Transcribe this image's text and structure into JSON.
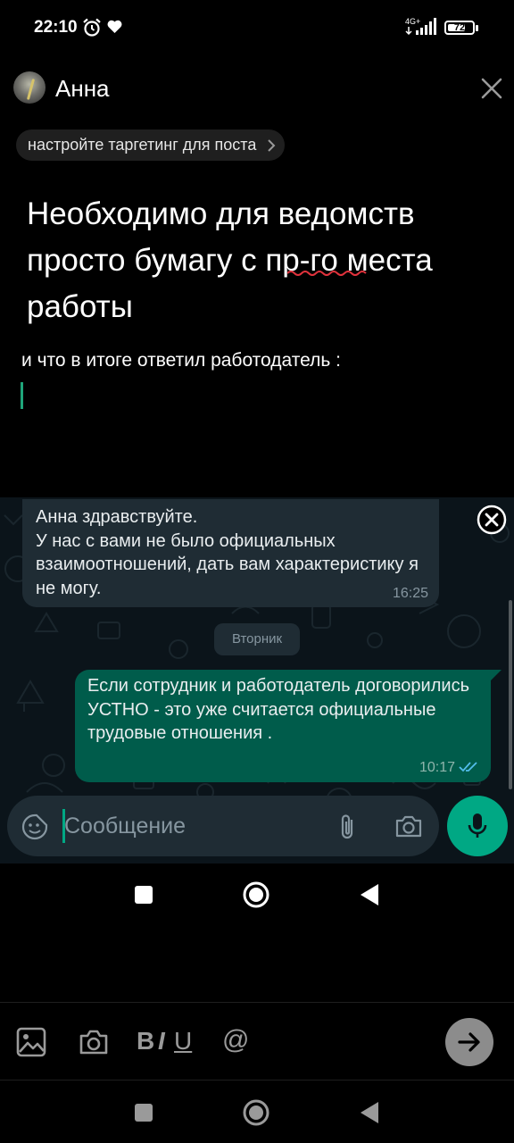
{
  "status_bar": {
    "time": "22:10",
    "network": "4G+",
    "battery": "72",
    "battery_level": 0.72
  },
  "header": {
    "contact_name": "Анна"
  },
  "chip": {
    "label": "настройте таргетинг для поста"
  },
  "post": {
    "headline": "Необходимо для ведомств просто бумагу с пр-го места работы",
    "body": "и что в итоге ответил работодатель :"
  },
  "chat": {
    "incoming": {
      "text": "Анна здравствуйте.\nУ нас с вами не было официальных взаимоотношений, дать вам характеристику я не могу.",
      "time": "16:25"
    },
    "day_label": "Вторник",
    "outgoing": {
      "text": "Если сотрудник и работодатель договорились УСТНО - это уже считается официальные трудовые отношения .",
      "time": "10:17"
    },
    "composer_placeholder": "Сообщение"
  },
  "toolbar": {
    "bold": "B",
    "italic": "I",
    "underline": "U",
    "mention": "@"
  },
  "colors": {
    "accent_green": "#00a884",
    "outgoing_bubble": "#005c4b",
    "incoming_bubble": "#1f2c34",
    "read_ticks": "#53bdeb"
  }
}
